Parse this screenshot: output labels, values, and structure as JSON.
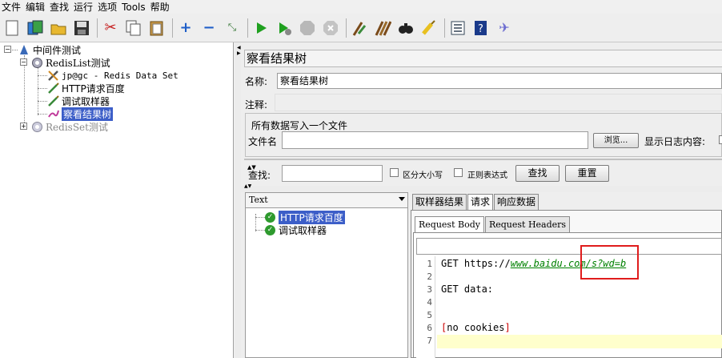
{
  "menu": [
    "文件",
    "编辑",
    "查找",
    "运行",
    "选项",
    "Tools",
    "帮助"
  ],
  "toolbar_icons": [
    "new-icon",
    "templates-icon",
    "open-icon",
    "save-icon",
    "cut-icon",
    "copy-icon",
    "paste-icon",
    "add-icon",
    "remove-icon",
    "toggle-icon",
    "start-icon",
    "start-no-pause-icon",
    "stop-icon",
    "shutdown-icon",
    "clear-icon",
    "clear-all-icon",
    "search-icon",
    "reset-search-icon",
    "function-helper-icon",
    "help-icon",
    "remote-icon"
  ],
  "tree": {
    "root": "中间件测试",
    "group1": "RedisList测试",
    "item1": "jp@gc - Redis Data Set",
    "item2": "HTTP请求百度",
    "item3": "调试取样器",
    "item4": "察看结果树",
    "group2": "RedisSet测试"
  },
  "panel": {
    "title": "察看结果树",
    "name_label": "名称:",
    "name_value": "察看结果树",
    "comment_label": "注释:",
    "comment_value": "",
    "file_group_title": "所有数据写入一个文件",
    "filename_label": "文件名",
    "filename_value": "",
    "browse_button": "浏览...",
    "log_label": "显示日志内容:"
  },
  "search": {
    "label": "查找:",
    "value": "",
    "case_label": "区分大小写",
    "regex_label": "正则表达式",
    "find_button": "查找",
    "reset_button": "重置"
  },
  "results": {
    "renderer": "Text",
    "items": [
      "HTTP请求百度",
      "调试取样器"
    ]
  },
  "tabs": [
    "取样器结果",
    "请求",
    "响应数据"
  ],
  "active_tab": "请求",
  "subtabs": [
    "Request Body",
    "Request Headers"
  ],
  "editor": {
    "line_numbers": [
      "1",
      "2",
      "3",
      "4",
      "5",
      "6",
      "7"
    ],
    "line1_prefix": "GET https://",
    "line1_url": "www.baidu.com/s?wd=b",
    "line3": "GET data:",
    "line6_open": "[",
    "line6_text": "no cookies",
    "line6_close": "]"
  },
  "colors": {
    "selection": "#3c5ec8",
    "url_green": "#008000",
    "annotation_red": "#e01c1c",
    "current_line": "#ffffcc"
  }
}
